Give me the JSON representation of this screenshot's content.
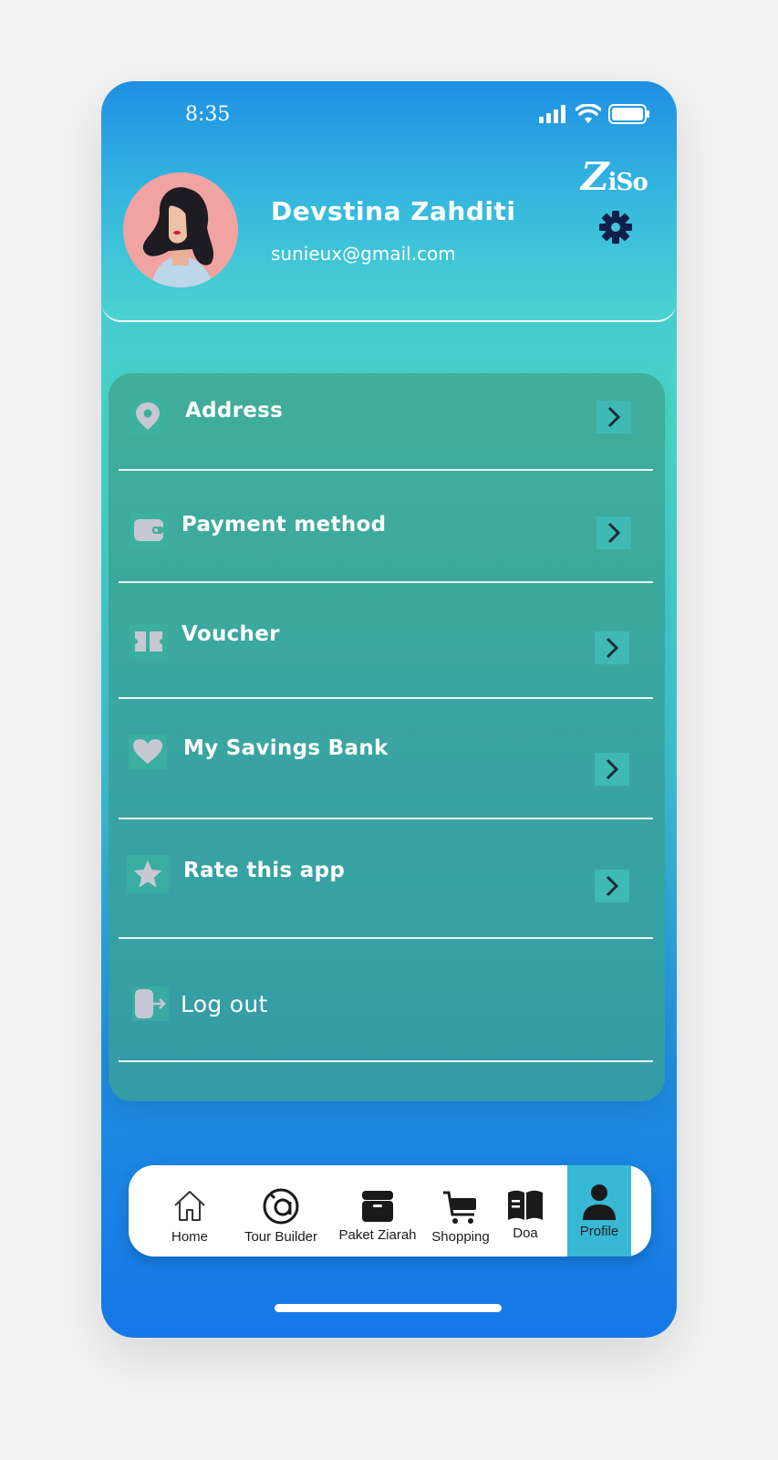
{
  "status_bar": {
    "time": "8:35"
  },
  "brand": {
    "logo_z": "Z",
    "logo_rest": "iSo"
  },
  "profile": {
    "name": "Devstina Zahditi",
    "email": "sunieux@gmail.com"
  },
  "menu": {
    "items": [
      {
        "label": "Address",
        "icon": "location-pin-icon"
      },
      {
        "label": "Payment method",
        "icon": "wallet-icon"
      },
      {
        "label": "Voucher",
        "icon": "ticket-icon"
      },
      {
        "label": "My Savings Bank",
        "icon": "heart-icon"
      },
      {
        "label": "Rate this app",
        "icon": "star-icon"
      },
      {
        "label": "Log out",
        "icon": "logout-icon"
      }
    ]
  },
  "tabbar": {
    "tabs": [
      {
        "label": "Home",
        "icon": "home-icon"
      },
      {
        "label": "Tour Builder",
        "icon": "tour-builder-icon"
      },
      {
        "label": "Paket Ziarah",
        "icon": "package-box-icon"
      },
      {
        "label": "Shopping",
        "icon": "cart-icon"
      },
      {
        "label": "Doa",
        "icon": "book-icon"
      },
      {
        "label": "Profile",
        "icon": "user-icon"
      }
    ],
    "active": "Profile",
    "active_color": "#37b9d6"
  },
  "colors": {
    "header_top": "#1f8fe3",
    "menu_card": "#3aa6a0",
    "gear": "#0f1f4a"
  }
}
